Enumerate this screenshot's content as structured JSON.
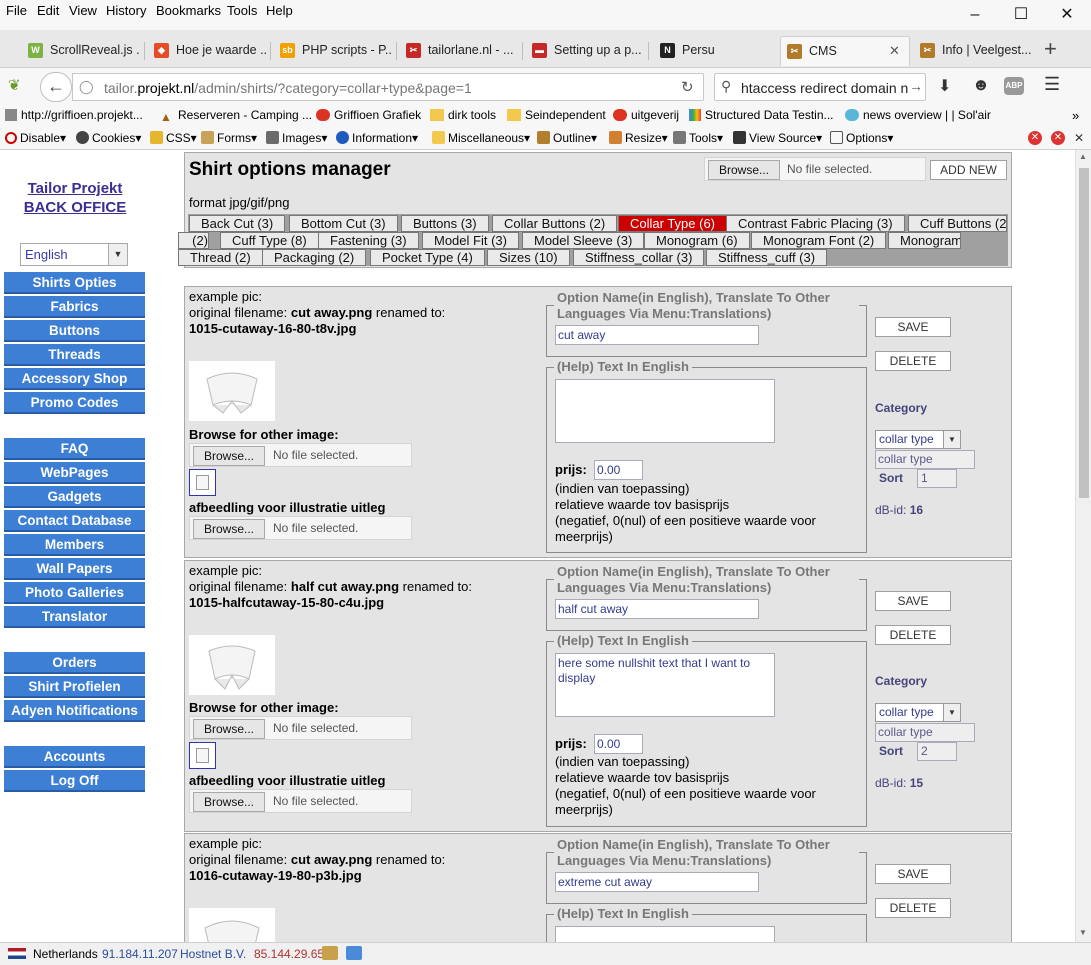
{
  "menu": [
    "File",
    "Edit",
    "View",
    "History",
    "Bookmarks",
    "Tools",
    "Help"
  ],
  "tabs": [
    {
      "label": "ScrollReveal.js ...",
      "color": "#7cb342",
      "glyph": "W"
    },
    {
      "label": "Hoe je waarde ...",
      "color": "#e44d26",
      "glyph": "◆"
    },
    {
      "label": "PHP scripts - P...",
      "color": "#f0a000",
      "glyph": "sb"
    },
    {
      "label": "tailorlane.nl - ...",
      "color": "#c62828",
      "glyph": "✂"
    },
    {
      "label": "Setting up a p...",
      "color": "#c62828",
      "glyph": "▬"
    },
    {
      "label": "Persu",
      "color": "#222",
      "glyph": "N"
    },
    {
      "label": "CMS",
      "color": "#b27b2b",
      "glyph": "✂"
    },
    {
      "label": "Info | Veelgest...",
      "color": "#b27b2b",
      "glyph": "✂"
    }
  ],
  "nav": {
    "url_host_pre": "tailor.",
    "url_host": "projekt.nl",
    "url_path": "/admin/shirts/?category=collar+type&page=1",
    "search_value": "htaccess redirect domain n"
  },
  "bookmarks": [
    "http://griffioen.projekt...",
    "Reserveren - Camping ...",
    "Griffioen Grafiek",
    "dirk tools",
    "Seindependent",
    "uitgeverij",
    "Structured Data Testin...",
    "news overview | | Sol'air"
  ],
  "devtools": [
    "Disable▾",
    "Cookies▾",
    "CSS▾",
    "Forms▾",
    "Images▾",
    "Information▾",
    "Miscellaneous▾",
    "Outline▾",
    "Resize▾",
    "Tools▾",
    "View Source▾",
    "Options▾"
  ],
  "sidebar": {
    "logo_line1": "Tailor Projekt",
    "logo_line2": "BACK OFFICE",
    "language": "English",
    "group1": [
      "Shirts Opties",
      "Fabrics",
      "Buttons",
      "Threads",
      "Accessory Shop",
      "Promo Codes"
    ],
    "group2": [
      "FAQ",
      "WebPages",
      "Gadgets",
      "Contact Database",
      "Members",
      "Wall Papers",
      "Photo Galleries",
      "Translator"
    ],
    "group3": [
      "Orders",
      "Shirt Profielen",
      "Adyen Notifications"
    ],
    "group4": [
      "Accounts",
      "Log Off"
    ]
  },
  "header": {
    "title": "Shirt options manager",
    "browse": "Browse...",
    "no_file": "No file selected.",
    "add_new": "ADD NEW",
    "format": "format jpg/gif/png"
  },
  "categories": [
    "Back Cut (3)",
    "Bottom Cut (3)",
    "Buttons (3)",
    "Collar Buttons (2)",
    "Collar Type (6)",
    "Contrast Fabric Placing (3)",
    "Cuff Buttons (2)",
    "Cuff Type (8)",
    "Fastening (3)",
    "Model Fit (3)",
    "Model Sleeve (3)",
    "Monogram (6)",
    "Monogram Font (2)",
    "Monogram Thread (2)",
    "Packaging (2)",
    "Pocket Type (4)",
    "Sizes (10)",
    "Stiffness_collar (3)",
    "Stiffness_cuff (3)"
  ],
  "labels": {
    "example_pic": "example pic:",
    "original_filename": "original filename:",
    "renamed_to": "renamed to:",
    "browse_other": "Browse for other image:",
    "illustratie": "afbeedling voor illustratie uitleg",
    "browse": "Browse...",
    "no_file": "No file selected.",
    "option_name_legend": "Option Name(in English), Translate To Other Languages Via Menu:Translations)",
    "help_legend": "(Help) Text In English",
    "prijs": "prijs:",
    "prijs_note1": "(indien van toepassing)",
    "prijs_note2": "relatieve waarde tov basisprijs",
    "prijs_note3": "(negatief, 0(nul) of een positieve waarde voor meerprijs)",
    "save": "SAVE",
    "delete": "DELETE",
    "category": "Category",
    "sort": "Sort",
    "dbid": "dB-id:"
  },
  "records": [
    {
      "orig": "cut away.png",
      "renamed": "1015-cutaway-16-80-t8v.jpg",
      "name": "cut away",
      "help": "",
      "price": "0.00",
      "cat_select": "collar type",
      "cat_text": "collar type",
      "sort": "1",
      "dbid": "16"
    },
    {
      "orig": "half cut away.png",
      "renamed": "1015-halfcutaway-15-80-c4u.jpg",
      "name": "half cut away",
      "help": "here some nullshit text that I want to display",
      "price": "0.00",
      "cat_select": "collar type",
      "cat_text": "collar type",
      "sort": "2",
      "dbid": "15"
    },
    {
      "orig": "cut away.png",
      "renamed": "1016-cutaway-19-80-p3b.jpg",
      "name": "extreme cut away",
      "help": "",
      "price": "",
      "cat_select": "",
      "cat_text": "",
      "sort": "",
      "dbid": ""
    }
  ],
  "status": {
    "country": "Netherlands",
    "ip1": "91.184.11.207",
    "host": "Hostnet B.V.",
    "ip2": "85.144.29.65"
  },
  "colors": {
    "accent_blue": "#3d7fd5",
    "selected_tab": "#cc0000",
    "panel": "#e4e4e4"
  }
}
